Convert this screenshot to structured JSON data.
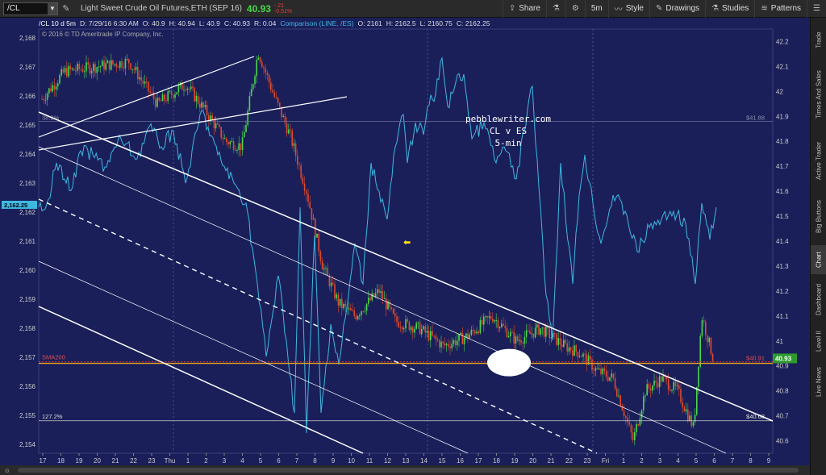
{
  "toolbar": {
    "symbol": "/CL",
    "description": "Light Sweet Crude Oil Futures,ETH (SEP 16)",
    "last": "40.93",
    "change": "-.21",
    "change_pct": "-0.51%",
    "share": "Share",
    "timeframe": "5m",
    "style": "Style",
    "drawings": "Drawings",
    "studies": "Studies",
    "patterns": "Patterns"
  },
  "info_bar": {
    "title": "/CL 10 d 5m",
    "date": "D: 7/29/16 6:30 AM",
    "open": "O: 40.9",
    "high": "H: 40.94",
    "low": "L: 40.9",
    "close": "C: 40.93",
    "range": "R: 0.04",
    "comparison": "Comparison (LINE, /ES)",
    "c_open": "O: 2161",
    "c_high": "H: 2162.5",
    "c_low": "L: 2160.75",
    "c_close": "C: 2162.25"
  },
  "copyright": "© 2016 © TD Ameritrade IP Company, Inc.",
  "annotation": {
    "line1": "pebblewriter.com",
    "line2": "CL v ES",
    "line3": "5-min"
  },
  "chart_labels": {
    "fib_top": "38.2%",
    "fib_top_value": "$41.88",
    "sma_label": "SMA200",
    "sma_value": "$40.91",
    "fib_bottom": "127.2%",
    "fib_bottom_value": "$40.68",
    "current_price": "40.93",
    "left_price_marker": "2,162.25"
  },
  "chart_data": {
    "type": "line",
    "left_axis": [
      "2,168",
      "2,167",
      "2,166",
      "2,165",
      "2,164",
      "2,163",
      "2,162",
      "2,161",
      "2,160",
      "2,159",
      "2,158",
      "2,157",
      "2,156",
      "2,155",
      "2,154"
    ],
    "right_axis": [
      "42.2",
      "42.1",
      "42",
      "41.9",
      "41.8",
      "41.7",
      "41.6",
      "41.5",
      "41.4",
      "41.3",
      "41.2",
      "41.1",
      "41",
      "40.9",
      "40.8",
      "40.7",
      "40.6"
    ],
    "x_axis": [
      "17",
      "18",
      "19",
      "20",
      "21",
      "22",
      "23",
      "Thu",
      "1",
      "2",
      "3",
      "4",
      "5",
      "6",
      "7",
      "8",
      "9",
      "10",
      "11",
      "12",
      "13",
      "14",
      "15",
      "16",
      "17",
      "18",
      "19",
      "20",
      "21",
      "22",
      "23",
      "Fri",
      "1",
      "2",
      "3",
      "4",
      "5",
      "6",
      "7",
      "8",
      "9"
    ],
    "levels": {
      "fib_382": 41.88,
      "sma200": 40.91,
      "fib_1272": 40.68
    },
    "ylim_right": [
      40.55,
      42.25
    ],
    "ylim_left": [
      2153.7,
      2168.3
    ]
  },
  "colors": {
    "background": "#1a1f5a",
    "es_line": "#3fb8e0",
    "up_candle": "#4cd64c",
    "down_candle": "#e04a2a",
    "sma": "#e8a020",
    "trendline": "#ffffff"
  },
  "right_tabs": [
    "Trade",
    "Times And Sales",
    "Active Trader",
    "Big Buttons",
    "Chart",
    "Dashboard",
    "Level II",
    "Live News"
  ]
}
